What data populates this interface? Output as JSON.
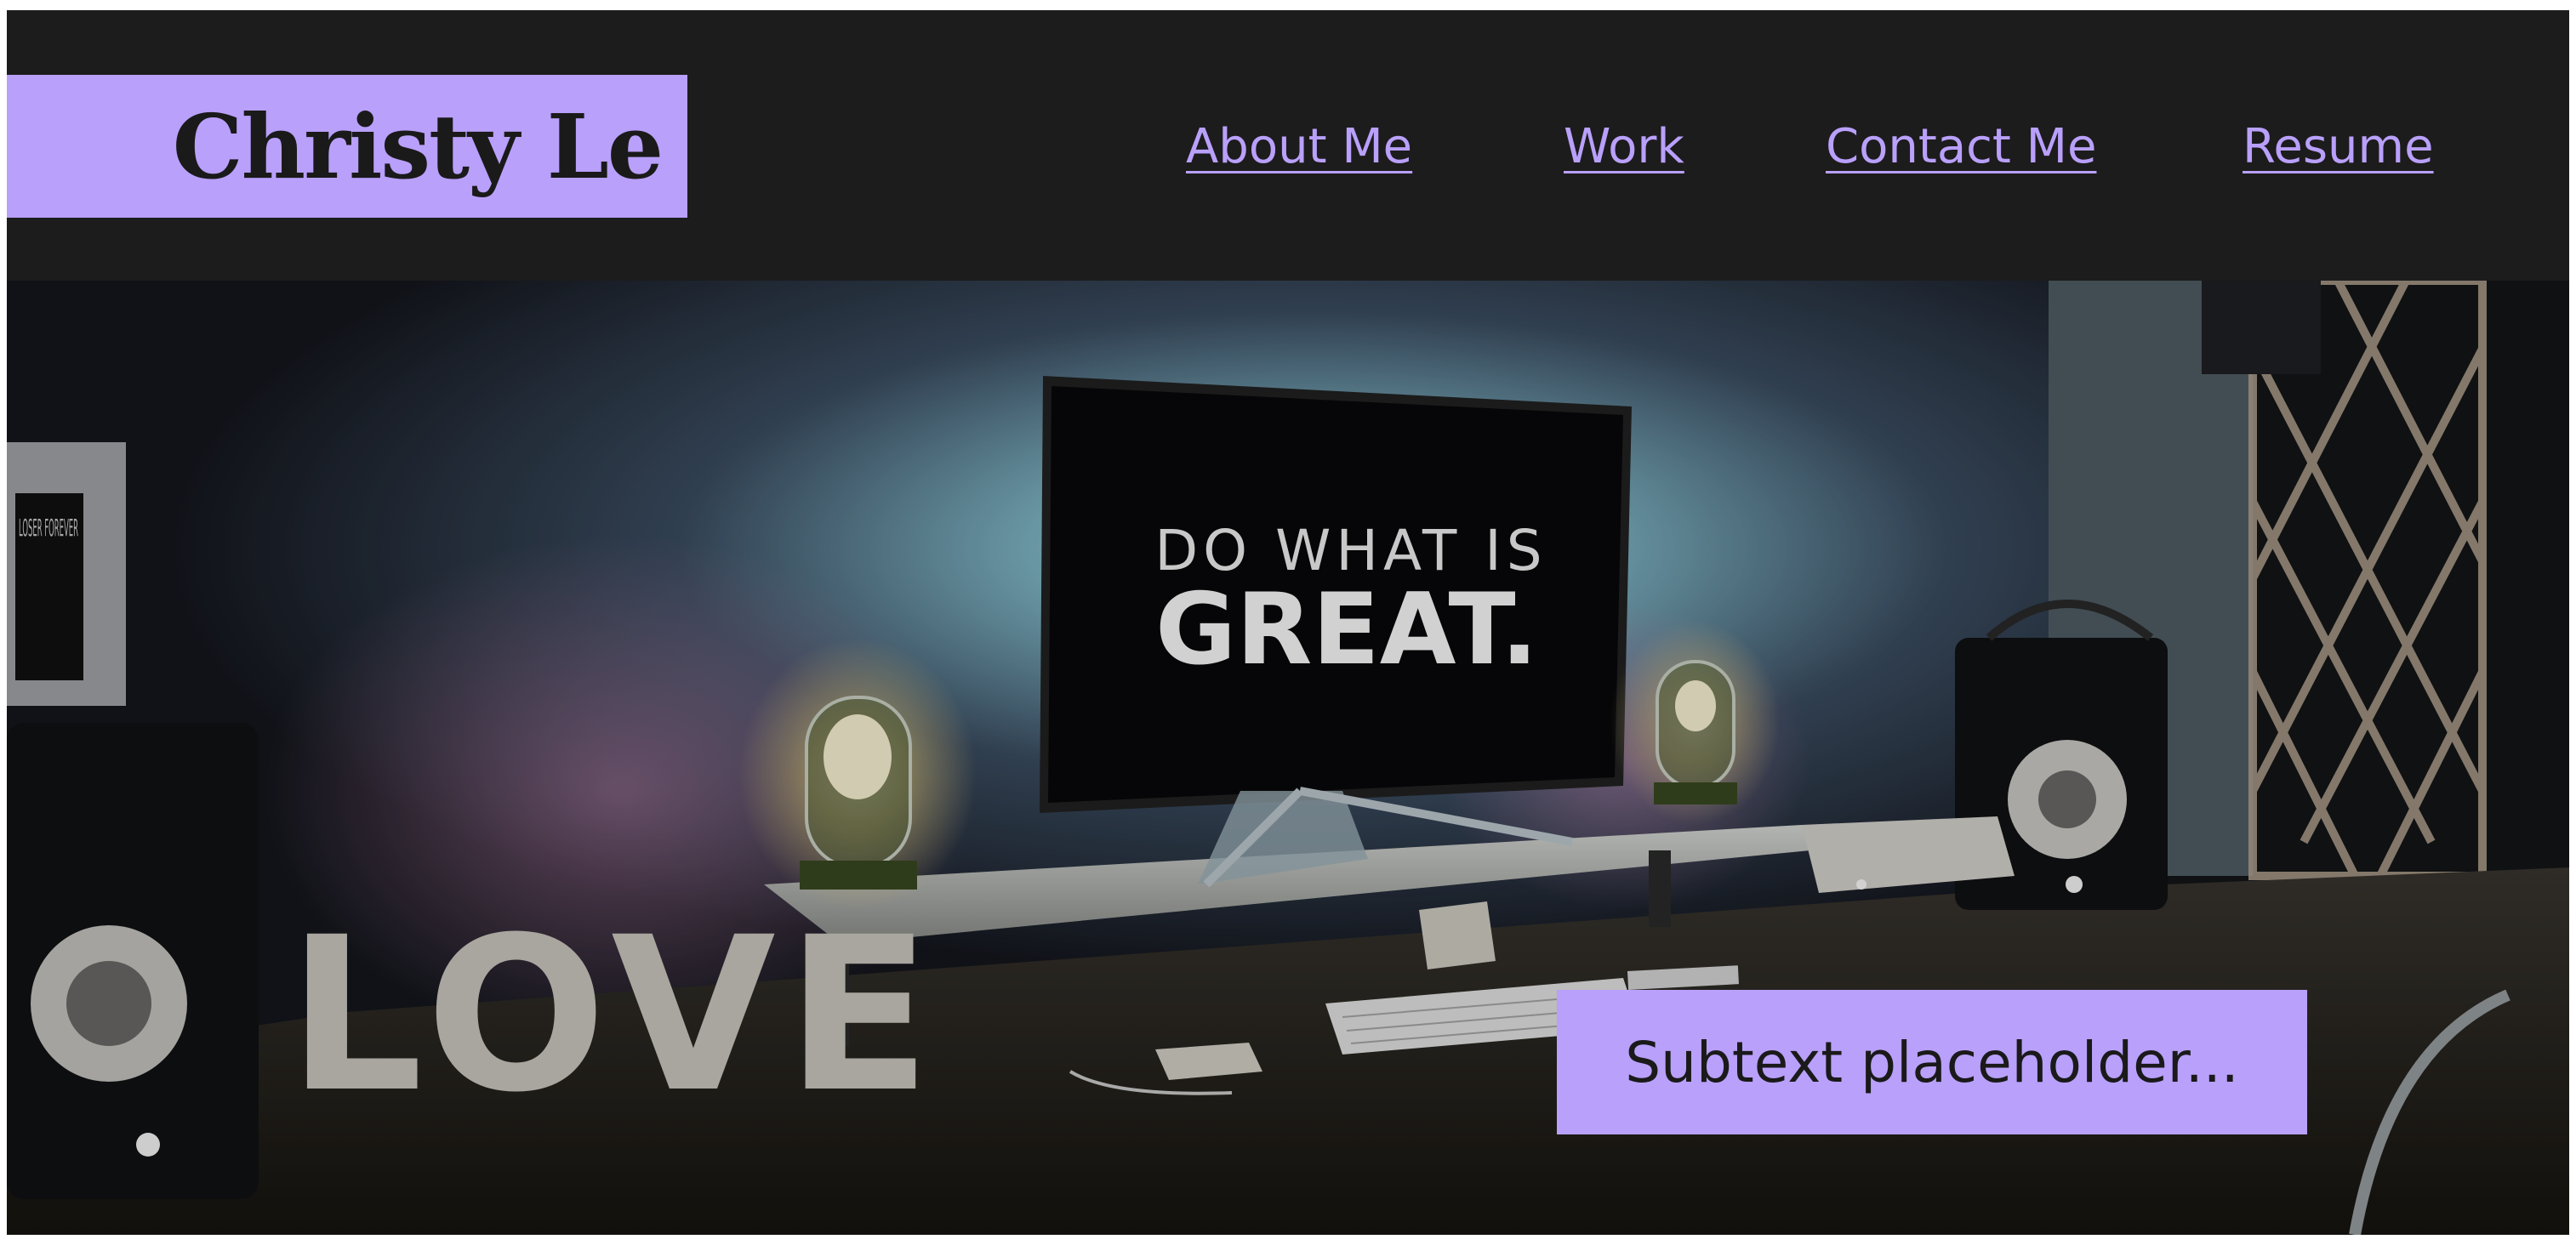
{
  "header": {
    "brand_name": "Christy Le",
    "nav": [
      {
        "label": "About Me"
      },
      {
        "label": "Work"
      },
      {
        "label": "Contact Me"
      },
      {
        "label": "Resume"
      }
    ]
  },
  "hero": {
    "monitor_line1": "DO WHAT IS",
    "monitor_line2": "GREAT.",
    "desk_letters": "LOVE",
    "poster_text": "LOSER FOREVER",
    "subtext": "Subtext placeholder..."
  },
  "colors": {
    "accent": "#b9a0fb",
    "header_bg": "#1c1c1c",
    "text_dark": "#1a1a1a"
  }
}
